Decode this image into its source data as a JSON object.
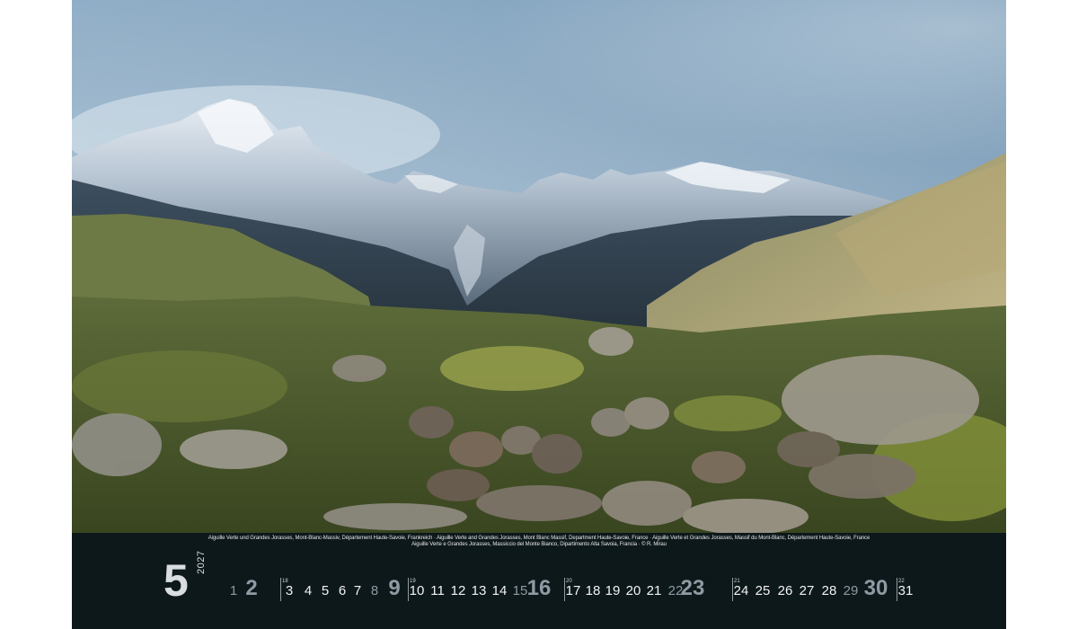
{
  "photo": {
    "subject": "Aiguille Verte und Grandes Jorasses, Mont-Blanc-Massiv"
  },
  "caption": {
    "line1": "Aiguille Verte und Grandes Jorasses, Mont-Blanc-Massiv, Département Haute-Savoie, Frankreich · Aiguille Verte and Grandes Jorasses, Mont Blanc Massif, Department Haute-Savoie, France · Aiguille Verte et Grandes Jorasses, Massif du Mont-Blanc, Département Haute-Savoie, France",
    "line2": "Aiguille Verte e Grandes Jorasses, Massiccio del Monte Bianco, Dipartimento Alta Savoia, Francia · © R. Mirau"
  },
  "calendar": {
    "month": "5",
    "year": "2027",
    "days": [
      "1",
      "2",
      "3",
      "4",
      "5",
      "6",
      "7",
      "8",
      "9",
      "10",
      "11",
      "12",
      "13",
      "14",
      "15",
      "16",
      "17",
      "18",
      "19",
      "20",
      "21",
      "22",
      "23",
      "24",
      "25",
      "26",
      "27",
      "28",
      "29",
      "30",
      "31"
    ],
    "week_numbers": [
      "18",
      "19",
      "20",
      "21",
      "22"
    ]
  },
  "colors": {
    "footer_bg": "#0d181b",
    "weekday_text": "#f2f2f2",
    "weekend_text": "#8f9aa3"
  }
}
